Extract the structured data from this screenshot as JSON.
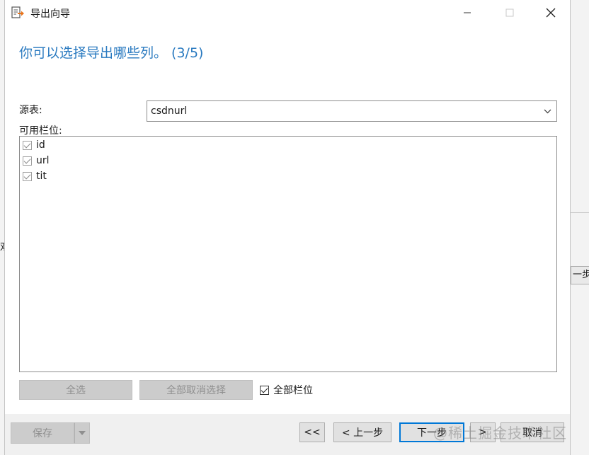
{
  "window": {
    "title": "导出向导",
    "minimize_label": "—",
    "maximize_label": "☐",
    "close_label": "✕"
  },
  "step_title": "你可以选择导出哪些列。 (3/5)",
  "source_table": {
    "label": "源表:",
    "value": "csdnurl"
  },
  "available_fields": {
    "label": "可用栏位:",
    "items": [
      {
        "name": "id",
        "checked": true
      },
      {
        "name": "url",
        "checked": true
      },
      {
        "name": "tit",
        "checked": true
      }
    ]
  },
  "buttons": {
    "select_all": "全选",
    "deselect_all": "全部取消选择",
    "all_fields": "全部栏位",
    "save": "保存",
    "first": "<<",
    "prev": "< 上一步",
    "next": "下一步",
    "next_arrow": ">",
    "last": ">>",
    "cancel": "取消"
  },
  "background": {
    "right_button_fragment": "一步"
  },
  "watermark": "@稀土掘金技术社区",
  "colors": {
    "accent": "#2a7ac0",
    "focus": "#0078d7",
    "disabled_bg": "#cccccc",
    "footer_bg": "#f0f0f0"
  }
}
